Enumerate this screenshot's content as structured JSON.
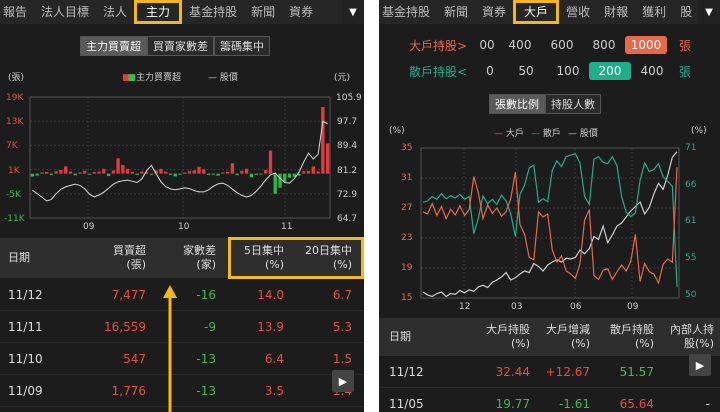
{
  "left": {
    "tabs": [
      "報告",
      "法人目標",
      "法人",
      "主力",
      "基金持股",
      "新聞",
      "資券"
    ],
    "active_tab": "主力",
    "menu_icon": "▼",
    "subtabs": [
      "主力買賣超",
      "買賣家數差",
      "籌碼集中"
    ],
    "chart": {
      "y_left_unit": "(張)",
      "y_right_unit": "(元)",
      "legend_bar": "主力買賣超",
      "legend_line": "股價",
      "y_left_ticks": [
        "19K",
        "13K",
        "7K",
        "1K",
        "-5K",
        "-11K"
      ],
      "y_right_ticks": [
        "105.9",
        "97.7",
        "89.4",
        "81.2",
        "72.9",
        "64.7"
      ],
      "x_ticks": [
        "09",
        "10",
        "11"
      ]
    },
    "chart_data": {
      "type": "bar",
      "title": "",
      "legend": [
        "主力買賣超",
        "股價"
      ],
      "x_ticks": [
        "09",
        "10",
        "11"
      ],
      "ylim_left": [
        -11000,
        19000
      ],
      "ylim_right": [
        64.7,
        105.9
      ],
      "series": [
        {
          "name": "主力買賣超",
          "values": [
            -700,
            -500,
            300,
            400,
            -300,
            600,
            900,
            1800,
            500,
            -400,
            300,
            700,
            -200,
            400,
            500,
            1200,
            -600,
            800,
            3800,
            2100,
            1200,
            400,
            -300,
            500,
            400,
            -200,
            800,
            1200,
            500,
            -300,
            -700,
            -200,
            300,
            600,
            800,
            1700,
            1100,
            -300,
            -200,
            -500,
            300,
            400,
            2600,
            -400,
            700,
            1200,
            -900,
            -300,
            -200,
            900,
            5700,
            -5000,
            -3500,
            -2000,
            -1000,
            -800,
            -500,
            600,
            700,
            1776,
            547,
            16559,
            7477
          ]
        },
        {
          "name": "股價",
          "values": [
            74.2,
            73.0,
            71.8,
            70.5,
            71.0,
            73.0,
            74.5,
            75.3,
            75.8,
            76.2,
            75.8,
            74.6,
            72.8,
            71.9,
            72.5,
            73.5,
            74.8,
            76.2,
            77.0,
            77.4,
            77.6,
            77.2,
            76.8,
            78.0,
            80.8,
            82.6,
            79.8,
            77.0,
            75.4,
            74.6,
            74.3,
            74.6,
            75.0,
            74.7,
            74.0,
            73.6,
            73.6,
            74.3,
            75.5,
            76.3,
            76.6,
            75.8,
            74.5,
            73.3,
            72.4,
            71.8,
            72.4,
            73.8,
            75.6,
            77.7,
            79.4,
            80.0,
            78.3,
            76.8,
            76.6,
            78.1,
            80.3,
            83.8,
            86.8,
            84.8,
            86.4,
            97.6,
            96.8
          ]
        }
      ]
    },
    "table": {
      "headers": [
        {
          "l1": "日期",
          "l2": ""
        },
        {
          "l1": "買賣超",
          "l2": "(張)"
        },
        {
          "l1": "家數差",
          "l2": "(家)"
        },
        {
          "l1": "5日集中",
          "l2": "(%)"
        },
        {
          "l1": "20日集中",
          "l2": "(%)"
        }
      ],
      "rows": [
        {
          "date": "11/12",
          "net": "7,477",
          "diff": "-16",
          "c5": "14.0",
          "c20": "6.7"
        },
        {
          "date": "11/11",
          "net": "16,559",
          "diff": "-9",
          "c5": "13.9",
          "c20": "5.3"
        },
        {
          "date": "11/10",
          "net": "547",
          "diff": "-13",
          "c5": "6.4",
          "c20": "1.5"
        },
        {
          "date": "11/09",
          "net": "1,776",
          "diff": "-13",
          "c5": "3.5",
          "c20": "1.4"
        }
      ]
    },
    "play_icon": "▶"
  },
  "right": {
    "tabs": [
      "基金持股",
      "新聞",
      "資券",
      "大戶",
      "營收",
      "財報",
      "獲利",
      "股"
    ],
    "active_tab": "大戶",
    "menu_icon": "▼",
    "big_label": "大戶持股>",
    "big_options": [
      "00",
      "400",
      "600",
      "800",
      "1000"
    ],
    "big_selected": "1000",
    "small_label": "散戶持股<",
    "small_options": [
      "0",
      "50",
      "100",
      "200",
      "400"
    ],
    "small_selected": "200",
    "unit": "張",
    "subtabs": [
      "張數比例",
      "持股人數"
    ],
    "chart": {
      "y_left_unit": "(%)",
      "y_right_unit": "(%)",
      "legend": [
        "大戶",
        "散戶",
        "股價"
      ],
      "y_left_ticks": [
        "35",
        "31",
        "27",
        "23",
        "19",
        "15"
      ],
      "y_right_ticks": [
        "71",
        "66",
        "61",
        "55",
        "50"
      ],
      "x_ticks": [
        "12",
        "03",
        "06",
        "09"
      ],
      "colors": {
        "big": "#e8684a",
        "small": "#1fae8c",
        "price": "#cfcfcf"
      }
    },
    "chart_data": {
      "type": "line",
      "legend": [
        "大戶",
        "散戶",
        "股價"
      ],
      "x_ticks": [
        "12",
        "03",
        "06",
        "09"
      ],
      "ylim_left": [
        15,
        35
      ],
      "ylim_right": [
        50,
        71
      ],
      "series": [
        {
          "name": "大戶",
          "axis": "left",
          "values": [
            26.5,
            26.2,
            27.6,
            26.0,
            27.2,
            25.6,
            26.8,
            26.1,
            27.3,
            26.0,
            26.8,
            31.2,
            29.0,
            25.6,
            27.4,
            26.3,
            27.0,
            25.9,
            26.5,
            28.2,
            31.8,
            24.8,
            23.5,
            20.4,
            20.1,
            26.5,
            25.8,
            26.2,
            21.4,
            19.8,
            20.6,
            18.6,
            18.2,
            17.6,
            19.6,
            25.4,
            26.8,
            18.0,
            17.5,
            18.7,
            18.9,
            17.5,
            18.5,
            19.4,
            18.6,
            19.9,
            23.5,
            17.2,
            19.6,
            18.5,
            18.2,
            17.0,
            19.5,
            20.2,
            19.77,
            32.44
          ]
        },
        {
          "name": "散戶",
          "axis": "right",
          "values": [
            63.4,
            63.6,
            64.2,
            63.8,
            64.6,
            63.9,
            64.3,
            64.0,
            64.5,
            63.8,
            64.2,
            59.0,
            61.2,
            64.3,
            63.2,
            63.8,
            63.1,
            64.4,
            63.6,
            61.8,
            58.6,
            64.5,
            65.8,
            68.2,
            68.6,
            63.4,
            63.9,
            63.5,
            67.9,
            69.2,
            68.4,
            69.8,
            70.0,
            70.2,
            68.9,
            64.2,
            63.1,
            69.4,
            69.8,
            69.0,
            68.8,
            69.8,
            68.5,
            64.2,
            62.0,
            61.4,
            61.9,
            66.5,
            68.9,
            67.7,
            68.0,
            68.8,
            67.0,
            66.3,
            65.64,
            51.57
          ]
        },
        {
          "name": "股價",
          "axis": "left",
          "values": [
            15.8,
            15.4,
            15.2,
            15.6,
            15.8,
            15.2,
            15.6,
            15.5,
            16.0,
            15.7,
            16.1,
            15.9,
            16.5,
            16.7,
            16.4,
            17.1,
            17.4,
            17.8,
            18.4,
            17.4,
            17.7,
            18.2,
            18.6,
            18.4,
            19.6,
            19.2,
            18.6,
            19.4,
            19.8,
            20.1,
            19.8,
            20.3,
            20.2,
            20.4,
            21.4,
            20.9,
            21.6,
            23.2,
            22.8,
            24.6,
            22.4,
            23.4,
            24.6,
            25.0,
            25.8,
            26.6,
            27.2,
            27.8,
            26.2,
            27.1,
            28.9,
            30.3,
            29.5,
            31.4,
            33.8,
            34.5
          ]
        }
      ]
    },
    "table": {
      "headers": [
        {
          "l1": "日期",
          "l2": ""
        },
        {
          "l1": "大戶持股",
          "l2": "(%)"
        },
        {
          "l1": "大戶增減",
          "l2": "(%)"
        },
        {
          "l1": "散戶持股",
          "l2": "(%)"
        },
        {
          "l1": "內部人持",
          "l2": "股(%)"
        }
      ],
      "rows": [
        {
          "date": "11/12",
          "big": "32.44",
          "chg": "+12.67",
          "small": "51.57",
          "ins": "-"
        },
        {
          "date": "11/05",
          "big": "19.77",
          "chg": "-1.61",
          "small": "65.64",
          "ins": "-"
        }
      ]
    },
    "play_icon": "▶"
  }
}
